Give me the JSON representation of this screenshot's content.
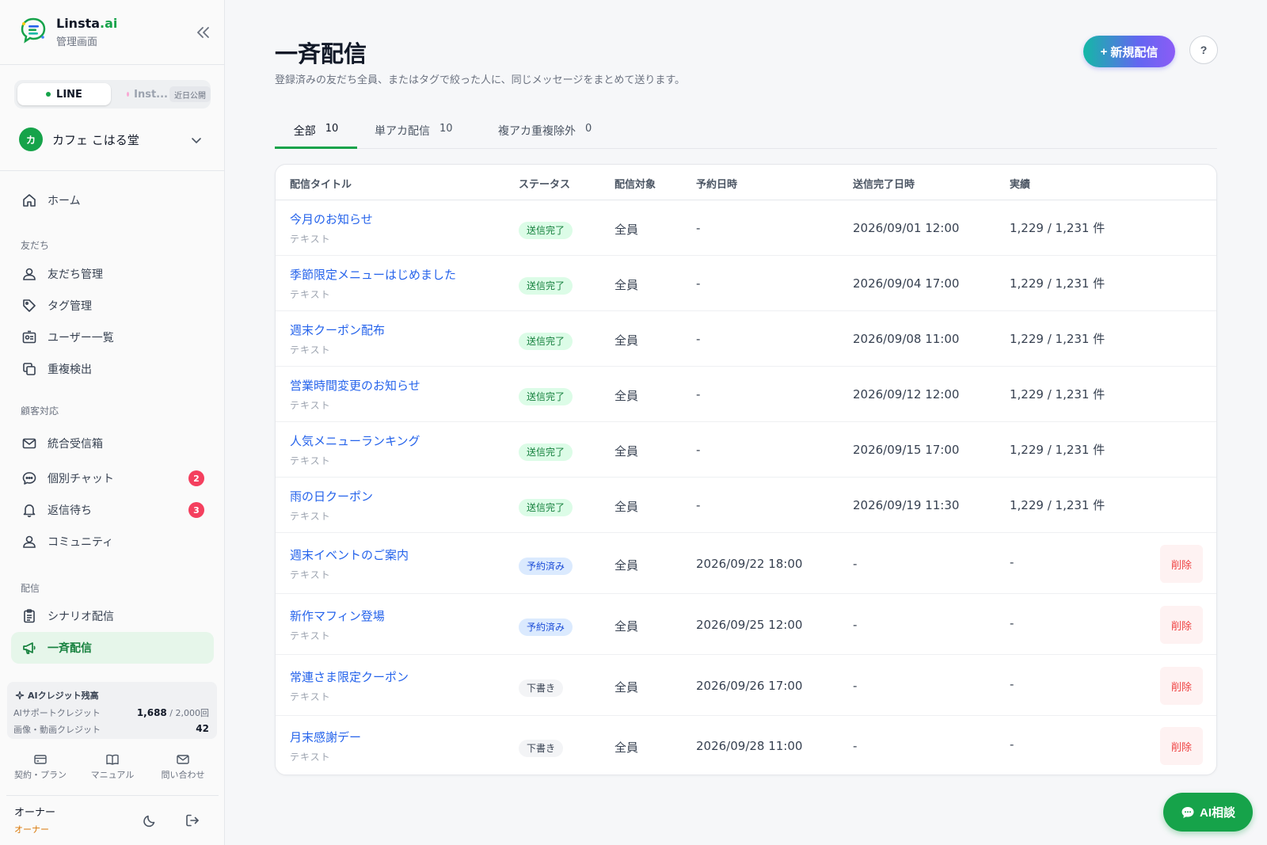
{
  "brand": {
    "name_main": "Linsta",
    "name_accent": ".ai",
    "subtitle": "管理画面"
  },
  "channels": {
    "line": "LINE",
    "instagram": "Inst...",
    "soon_badge": "近日公開"
  },
  "account": {
    "avatar_char": "カ",
    "name": "カフェ こはる堂"
  },
  "nav": {
    "home": "ホーム",
    "section_friends": "友だち",
    "friends": "友だち管理",
    "tags": "タグ管理",
    "users": "ユーザー一覧",
    "duplicates": "重複検出",
    "section_support": "顧客対応",
    "inbox": "統合受信箱",
    "chat": "個別チャット",
    "chat_badge": "2",
    "pending": "返信待ち",
    "pending_badge": "3",
    "community": "コミュニティ",
    "section_delivery": "配信",
    "scenario": "シナリオ配信",
    "broadcast": "一斉配信"
  },
  "credits": {
    "title": "AIクレジット残高",
    "support_label": "AIサポートクレジット",
    "support_used": "1,688",
    "support_total": "/ 2,000回",
    "media_label": "画像・動画クレジット",
    "media_value": "42"
  },
  "footer_links": {
    "plan": "契約・プラン",
    "manual": "マニュアル",
    "contact": "問い合わせ"
  },
  "user": {
    "name": "オーナー",
    "role": "オーナー"
  },
  "page": {
    "title": "一斉配信",
    "description": "登録済みの友だち全員、またはタグで絞った人に、同じメッセージをまとめて送ります。",
    "new_button": "新規配信",
    "help": "?"
  },
  "tabs": [
    {
      "label": "全部",
      "count": "10"
    },
    {
      "label": "単アカ配信",
      "count": "10"
    },
    {
      "label": "複アカ重複除外",
      "count": "0"
    }
  ],
  "table": {
    "headers": {
      "title": "配信タイトル",
      "status": "ステータス",
      "target": "配信対象",
      "scheduled": "予約日時",
      "completed": "送信完了日時",
      "result": "実績"
    },
    "delete_label": "削除",
    "rows": [
      {
        "title": "今月のお知らせ",
        "type": "テキスト",
        "status": "送信完了",
        "status_kind": "sent",
        "target": "全員",
        "scheduled": "-",
        "completed": "2026/09/01 12:00",
        "result": "1,229 / 1,231 件"
      },
      {
        "title": "季節限定メニューはじめました",
        "type": "テキスト",
        "status": "送信完了",
        "status_kind": "sent",
        "target": "全員",
        "scheduled": "-",
        "completed": "2026/09/04 17:00",
        "result": "1,229 / 1,231 件"
      },
      {
        "title": "週末クーポン配布",
        "type": "テキスト",
        "status": "送信完了",
        "status_kind": "sent",
        "target": "全員",
        "scheduled": "-",
        "completed": "2026/09/08 11:00",
        "result": "1,229 / 1,231 件"
      },
      {
        "title": "営業時間変更のお知らせ",
        "type": "テキスト",
        "status": "送信完了",
        "status_kind": "sent",
        "target": "全員",
        "scheduled": "-",
        "completed": "2026/09/12 12:00",
        "result": "1,229 / 1,231 件"
      },
      {
        "title": "人気メニューランキング",
        "type": "テキスト",
        "status": "送信完了",
        "status_kind": "sent",
        "target": "全員",
        "scheduled": "-",
        "completed": "2026/09/15 17:00",
        "result": "1,229 / 1,231 件"
      },
      {
        "title": "雨の日クーポン",
        "type": "テキスト",
        "status": "送信完了",
        "status_kind": "sent",
        "target": "全員",
        "scheduled": "-",
        "completed": "2026/09/19 11:30",
        "result": "1,229 / 1,231 件"
      },
      {
        "title": "週末イベントのご案内",
        "type": "テキスト",
        "status": "予約済み",
        "status_kind": "sched",
        "target": "全員",
        "scheduled": "2026/09/22 18:00",
        "completed": "-",
        "result": "-"
      },
      {
        "title": "新作マフィン登場",
        "type": "テキスト",
        "status": "予約済み",
        "status_kind": "sched",
        "target": "全員",
        "scheduled": "2026/09/25 12:00",
        "completed": "-",
        "result": "-"
      },
      {
        "title": "常連さま限定クーポン",
        "type": "テキスト",
        "status": "下書き",
        "status_kind": "draft",
        "target": "全員",
        "scheduled": "2026/09/26 17:00",
        "completed": "-",
        "result": "-"
      },
      {
        "title": "月末感謝デー",
        "type": "テキスト",
        "status": "下書き",
        "status_kind": "draft",
        "target": "全員",
        "scheduled": "2026/09/28 11:00",
        "completed": "-",
        "result": "-"
      }
    ]
  },
  "ai_chat": {
    "label": "AI相談"
  }
}
